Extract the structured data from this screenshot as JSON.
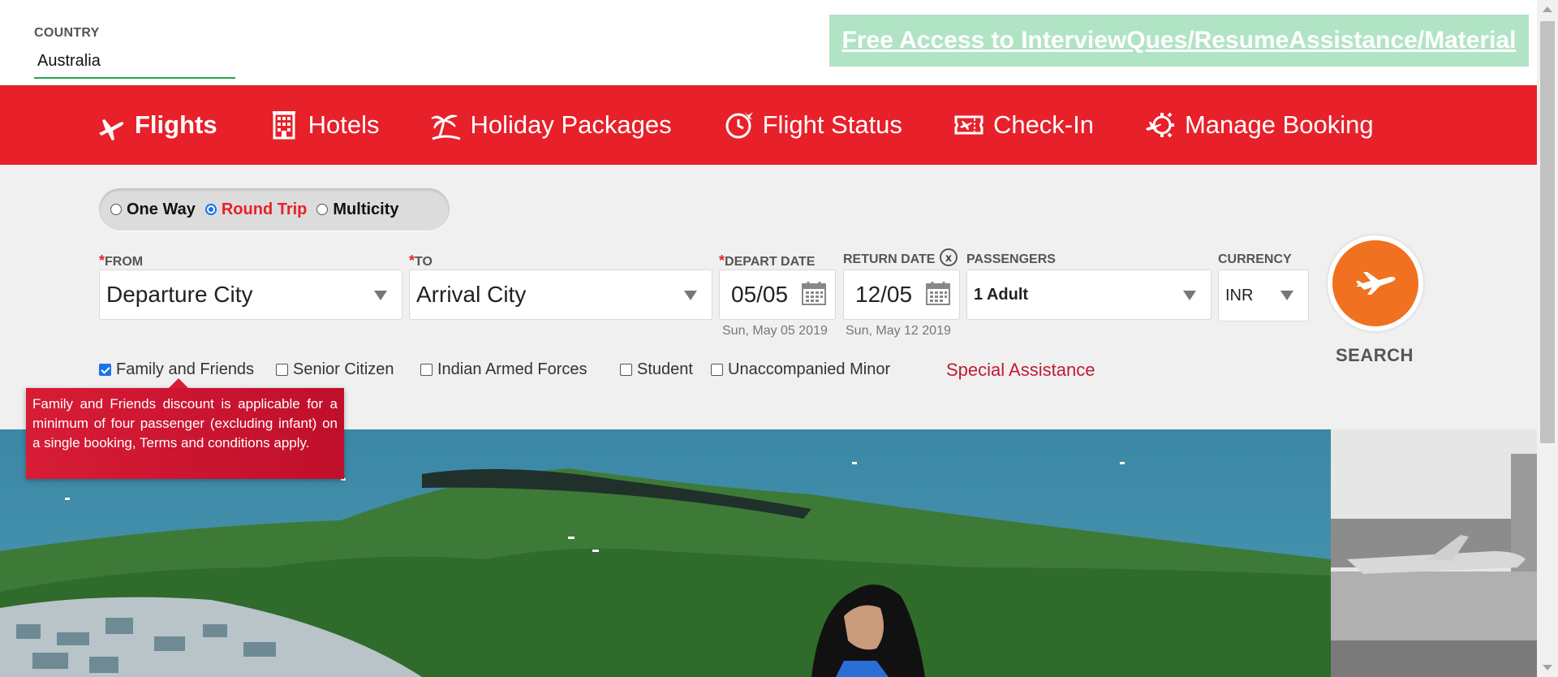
{
  "country": {
    "label": "COUNTRY",
    "value": "Australia"
  },
  "promo": {
    "text": "Free Access to InterviewQues/ResumeAssistance/Material"
  },
  "nav": {
    "items": [
      {
        "label": "Flights",
        "icon": "plane-icon",
        "active": true
      },
      {
        "label": "Hotels",
        "icon": "hotel-icon"
      },
      {
        "label": "Holiday Packages",
        "icon": "palm-tree-icon"
      },
      {
        "label": "Flight Status",
        "icon": "clock-plane-icon"
      },
      {
        "label": "Check-In",
        "icon": "boarding-pass-icon"
      },
      {
        "label": "Manage Booking",
        "icon": "gear-plane-icon"
      }
    ]
  },
  "trip": {
    "options": [
      "One Way",
      "Round Trip",
      "Multicity"
    ],
    "selected": "Round Trip"
  },
  "form": {
    "from_label": "FROM",
    "from_value": "Departure City",
    "to_label": "TO",
    "to_value": "Arrival City",
    "depart_label": "DEPART DATE",
    "depart_value": "05/05",
    "depart_full": "Sun, May 05 2019",
    "return_label": "RETURN DATE",
    "return_value": "12/05",
    "return_full": "Sun, May 12 2019",
    "clear_symbol": "x",
    "passengers_label": "PASSENGERS",
    "passengers_value": "1 Adult",
    "currency_label": "CURRENCY",
    "currency_value": "INR",
    "required_mark": "*"
  },
  "search": {
    "label": "SEARCH"
  },
  "concessions": {
    "items": [
      {
        "label": "Family and Friends",
        "checked": true
      },
      {
        "label": "Senior Citizen",
        "checked": false
      },
      {
        "label": "Indian Armed Forces",
        "checked": false
      },
      {
        "label": "Student",
        "checked": false
      },
      {
        "label": "Unaccompanied Minor",
        "checked": false
      }
    ],
    "special": "Special Assistance"
  },
  "tooltip": {
    "text": "Family and Friends discount is applicable for a minimum of four passenger (excluding infant) on a single booking, Terms and conditions apply."
  },
  "colors": {
    "brand_red": "#e8202a",
    "search_orange": "#f07120",
    "promo_bg": "#b1e4c5",
    "accent_blue": "#1a73e8"
  }
}
